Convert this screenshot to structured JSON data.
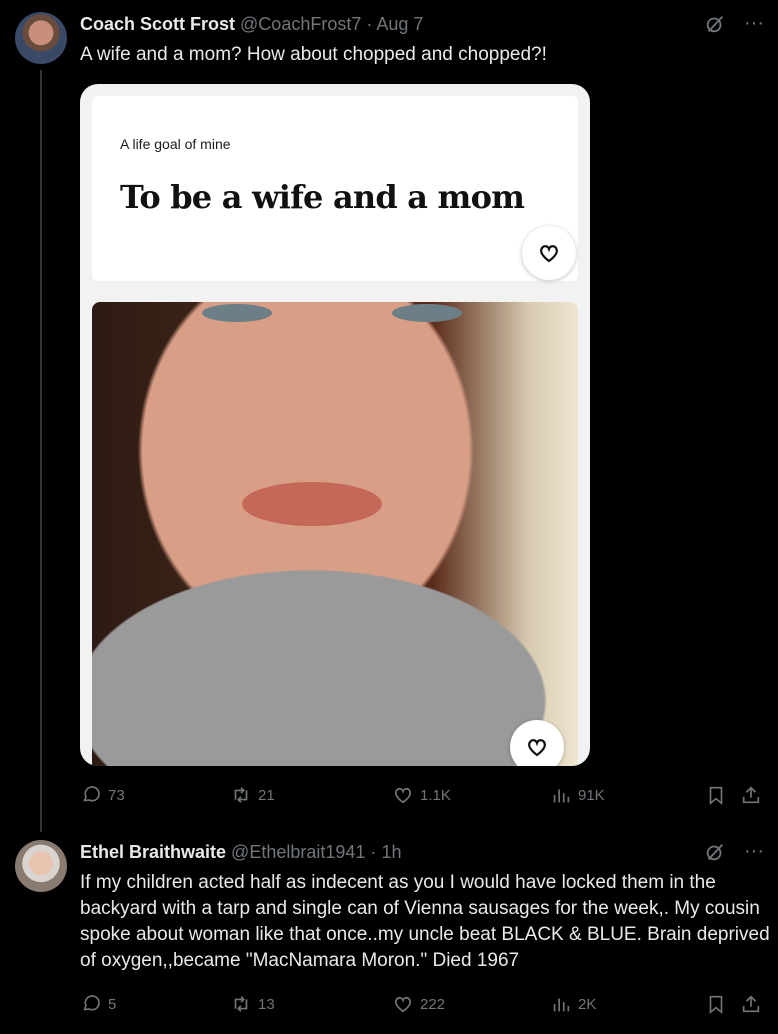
{
  "tweet1": {
    "name": "Coach Scott Frost",
    "handle": "@CoachFrost7",
    "time": "Aug 7",
    "text": "A wife and a mom? How about chopped and chopped?!",
    "media": {
      "card_subtitle": "A life goal of mine",
      "card_title": "To be a wife and a mom"
    },
    "actions": {
      "replies": "73",
      "reposts": "21",
      "likes": "1.1K",
      "views": "91K"
    }
  },
  "tweet2": {
    "name": "Ethel Braithwaite",
    "handle": "@Ethelbrait1941",
    "time": "1h",
    "text": "If my children acted half as indecent as you I would have locked them in the backyard with a tarp and single can of Vienna sausages for the week,. My cousin spoke about woman like that once..my uncle beat BLACK & BLUE. Brain deprived of oxygen,,became \"MacNamara Moron.\" Died 1967",
    "actions": {
      "replies": "5",
      "reposts": "13",
      "likes": "222",
      "views": "2K"
    }
  },
  "icons": {
    "reply": "reply-icon",
    "repost": "repost-icon",
    "like": "heart-icon",
    "views": "views-icon",
    "bookmark": "bookmark-icon",
    "share": "share-icon",
    "grok": "grok-icon",
    "more": "more-icon"
  },
  "colors": {
    "background": "#000000",
    "text": "#e7e9ea",
    "muted": "#71767b"
  }
}
